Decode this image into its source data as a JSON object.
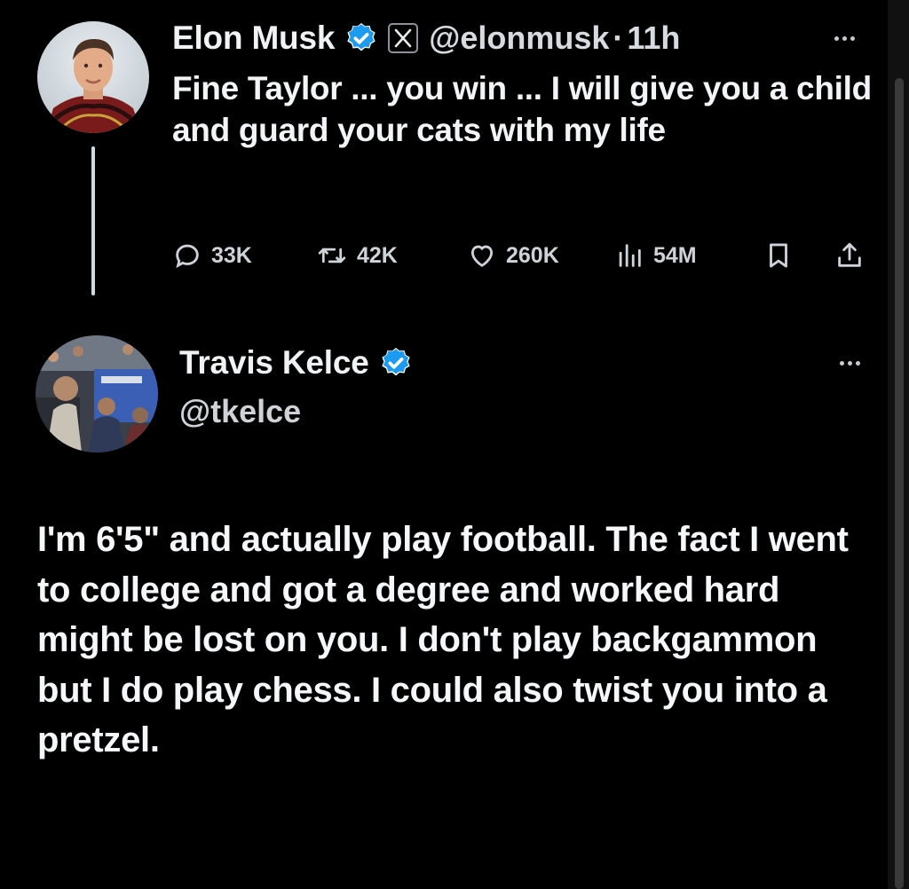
{
  "tweets": [
    {
      "author": {
        "name": "Elon Musk",
        "handle": "@elonmusk",
        "verified": true,
        "affiliate_icon": "x-logo-icon"
      },
      "separator": "·",
      "time": "11h",
      "text": "Fine Taylor ... you win ... I will give you a child and guard your cats with my life",
      "actions": {
        "replies": "33K",
        "reposts": "42K",
        "likes": "260K",
        "views": "54M"
      }
    },
    {
      "author": {
        "name": "Travis Kelce",
        "handle": "@tkelce",
        "verified": true
      },
      "text": "I'm 6'5\" and actually play football. The fact I went to college and got a degree and worked hard might be lost on you. I don't play backgammon but I do play chess. I could also twist you into a pretzel."
    }
  ],
  "colors": {
    "background": "#000000",
    "text": "#e7e9ea",
    "verified_badge": "#1d9bf0",
    "thread_line": "#cfd9de"
  },
  "icons": {
    "reply": "reply-icon",
    "repost": "repost-icon",
    "like": "heart-icon",
    "views": "views-chart-icon",
    "bookmark": "bookmark-icon",
    "share": "share-icon",
    "more": "more-dots-icon",
    "verified": "verified-badge-icon"
  }
}
